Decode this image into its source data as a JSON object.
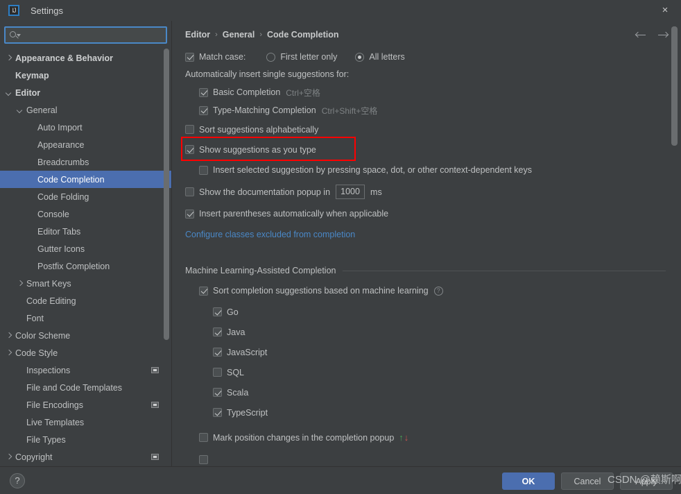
{
  "window": {
    "title": "Settings",
    "logo_text": "IJ",
    "close_icon": "×",
    "accent_blue": "#4b6eaf",
    "link_blue": "#4a88c7",
    "highlight_red": "#ff0000",
    "background": "#3c3f41"
  },
  "search": {
    "value": "",
    "placeholder": ""
  },
  "sidebar": {
    "items": [
      {
        "label": "Appearance & Behavior",
        "indent": 0,
        "arrow": "collapsed",
        "bold": true,
        "selected": false,
        "badge": false
      },
      {
        "label": "Keymap",
        "indent": 0,
        "arrow": "none",
        "bold": true,
        "selected": false,
        "badge": false
      },
      {
        "label": "Editor",
        "indent": 0,
        "arrow": "expanded",
        "bold": true,
        "selected": false,
        "badge": false
      },
      {
        "label": "General",
        "indent": 1,
        "arrow": "expanded",
        "bold": false,
        "selected": false,
        "badge": false
      },
      {
        "label": "Auto Import",
        "indent": 2,
        "arrow": "none",
        "bold": false,
        "selected": false,
        "badge": false
      },
      {
        "label": "Appearance",
        "indent": 2,
        "arrow": "none",
        "bold": false,
        "selected": false,
        "badge": false
      },
      {
        "label": "Breadcrumbs",
        "indent": 2,
        "arrow": "none",
        "bold": false,
        "selected": false,
        "badge": false
      },
      {
        "label": "Code Completion",
        "indent": 2,
        "arrow": "none",
        "bold": false,
        "selected": true,
        "badge": false
      },
      {
        "label": "Code Folding",
        "indent": 2,
        "arrow": "none",
        "bold": false,
        "selected": false,
        "badge": false
      },
      {
        "label": "Console",
        "indent": 2,
        "arrow": "none",
        "bold": false,
        "selected": false,
        "badge": false
      },
      {
        "label": "Editor Tabs",
        "indent": 2,
        "arrow": "none",
        "bold": false,
        "selected": false,
        "badge": false
      },
      {
        "label": "Gutter Icons",
        "indent": 2,
        "arrow": "none",
        "bold": false,
        "selected": false,
        "badge": false
      },
      {
        "label": "Postfix Completion",
        "indent": 2,
        "arrow": "none",
        "bold": false,
        "selected": false,
        "badge": false
      },
      {
        "label": "Smart Keys",
        "indent": 1,
        "arrow": "collapsed",
        "bold": false,
        "selected": false,
        "badge": false
      },
      {
        "label": "Code Editing",
        "indent": 1,
        "arrow": "none",
        "bold": false,
        "selected": false,
        "badge": false
      },
      {
        "label": "Font",
        "indent": 1,
        "arrow": "none",
        "bold": false,
        "selected": false,
        "badge": false
      },
      {
        "label": "Color Scheme",
        "indent": 0,
        "arrow": "collapsed",
        "bold": false,
        "selected": false,
        "badge": false
      },
      {
        "label": "Code Style",
        "indent": 0,
        "arrow": "collapsed",
        "bold": false,
        "selected": false,
        "badge": false
      },
      {
        "label": "Inspections",
        "indent": 1,
        "arrow": "none",
        "bold": false,
        "selected": false,
        "badge": true
      },
      {
        "label": "File and Code Templates",
        "indent": 1,
        "arrow": "none",
        "bold": false,
        "selected": false,
        "badge": false
      },
      {
        "label": "File Encodings",
        "indent": 1,
        "arrow": "none",
        "bold": false,
        "selected": false,
        "badge": true
      },
      {
        "label": "Live Templates",
        "indent": 1,
        "arrow": "none",
        "bold": false,
        "selected": false,
        "badge": false
      },
      {
        "label": "File Types",
        "indent": 1,
        "arrow": "none",
        "bold": false,
        "selected": false,
        "badge": false
      },
      {
        "label": "Copyright",
        "indent": 0,
        "arrow": "collapsed",
        "bold": false,
        "selected": false,
        "badge": true
      }
    ]
  },
  "content": {
    "breadcrumb": [
      "Editor",
      "General",
      "Code Completion"
    ],
    "breadcrumb_sep": "›",
    "match_case": {
      "label": "Match case:",
      "checked": true,
      "options": [
        {
          "label": "First letter only",
          "selected": false
        },
        {
          "label": "All letters",
          "selected": true
        }
      ]
    },
    "auto_insert_label": "Automatically insert single suggestions for:",
    "auto_insert_items": [
      {
        "label": "Basic Completion",
        "shortcut": "Ctrl+空格",
        "checked": true
      },
      {
        "label": "Type-Matching Completion",
        "shortcut": "Ctrl+Shift+空格",
        "checked": true
      }
    ],
    "sort_alpha": {
      "label": "Sort suggestions alphabetically",
      "checked": false
    },
    "show_as_you_type": {
      "label": "Show suggestions as you type",
      "checked": true,
      "highlighted": true
    },
    "insert_selected": {
      "label": "Insert selected suggestion by pressing space, dot, or other context-dependent keys",
      "checked": false
    },
    "doc_popup": {
      "label_before": "Show the documentation popup in",
      "value": "1000",
      "label_after": "ms",
      "checked": false
    },
    "insert_parens": {
      "label": "Insert parentheses automatically when applicable",
      "checked": true
    },
    "configure_link": "Configure classes excluded from completion",
    "ml_section": {
      "title": "Machine Learning-Assisted Completion",
      "sort_ml": {
        "label": "Sort completion suggestions based on machine learning",
        "checked": true,
        "help_icon": "?"
      },
      "languages": [
        {
          "label": "Go",
          "checked": true
        },
        {
          "label": "Java",
          "checked": true
        },
        {
          "label": "JavaScript",
          "checked": true
        },
        {
          "label": "SQL",
          "checked": false
        },
        {
          "label": "Scala",
          "checked": true
        },
        {
          "label": "TypeScript",
          "checked": true
        }
      ],
      "mark_position": {
        "label": "Mark position changes in the completion popup",
        "checked": false,
        "up_icon": "↑",
        "down_icon": "↓"
      }
    }
  },
  "bottom": {
    "help_label": "?",
    "ok_label": "OK",
    "cancel_label": "Cancel",
    "apply_label": "Apply"
  },
  "watermark": "CSDN @赖斯啊"
}
